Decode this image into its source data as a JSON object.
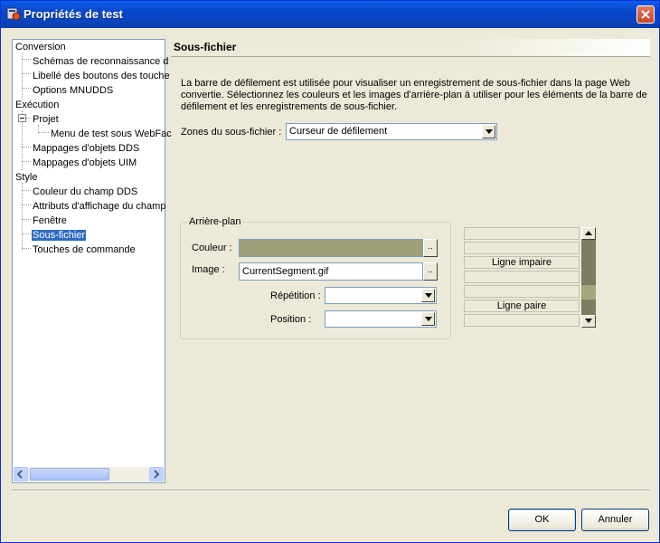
{
  "window": {
    "title": "Propriétés de test"
  },
  "tree": {
    "items": [
      {
        "label": "Conversion"
      },
      {
        "label": "Schémas de reconnaissance d"
      },
      {
        "label": "Libellé des boutons des touche"
      },
      {
        "label": "Options MNUDDS"
      },
      {
        "label": "Exécution"
      },
      {
        "label": "Projet"
      },
      {
        "label": "Menu de test sous WebFac"
      },
      {
        "label": "Mappages d'objets DDS"
      },
      {
        "label": "Mappages d'objets UIM"
      },
      {
        "label": "Style"
      },
      {
        "label": "Couleur du champ DDS"
      },
      {
        "label": "Attributs d'affichage du champ"
      },
      {
        "label": "Fenêtre"
      },
      {
        "label": "Sous-fichier"
      },
      {
        "label": "Touches de commande"
      }
    ]
  },
  "panel": {
    "title": "Sous-fichier",
    "description": "La barre de défilement est utilisée pour visualiser un enregistrement de sous-fichier dans la page Web convertie.  Sélectionnez les couleurs et les images d'arrière-plan à utiliser pour les éléments de la barre de défilement et les enregistrements de sous-fichier.",
    "zones_label": "Zones du sous-fichier :",
    "zones_value": "Curseur de défilement",
    "background_group": "Arrière-plan",
    "color_label": "Couleur :",
    "color_value": "#a0a07a",
    "image_label": "Image :",
    "image_value": "CurrentSegment.gif",
    "repeat_label": "Répétition :",
    "repeat_value": "",
    "position_label": "Position :",
    "position_value": "",
    "ellipsis": "..",
    "preview": {
      "odd_row": "Ligne impaire",
      "even_row": "Ligne paire"
    }
  },
  "buttons": {
    "ok": "OK",
    "cancel": "Annuler"
  }
}
